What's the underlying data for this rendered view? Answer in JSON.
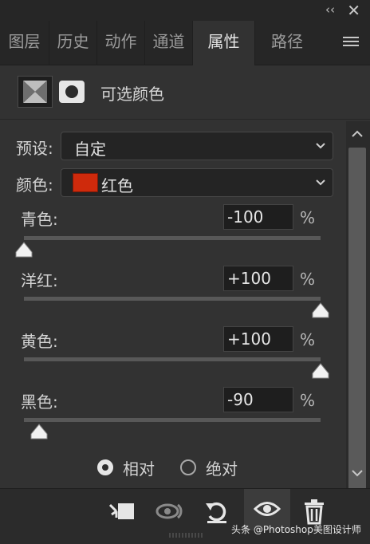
{
  "window": {
    "collapse_icon": "double-chevron-icon",
    "close_icon": "close-icon",
    "collapse_glyph": "‹‹",
    "close_glyph": "✕"
  },
  "tabs": [
    {
      "label": "图层",
      "active": false
    },
    {
      "label": "历史",
      "active": false
    },
    {
      "label": "动作",
      "active": false
    },
    {
      "label": "通道",
      "active": false
    },
    {
      "label": "属性",
      "active": true
    },
    {
      "label": "路径",
      "active": false
    }
  ],
  "panel": {
    "title": "可选颜色"
  },
  "preset": {
    "label": "预设:",
    "value": "自定"
  },
  "colors": {
    "label": "颜色:",
    "value": "红色",
    "swatch": "#cf2a0c"
  },
  "sliders": [
    {
      "label": "青色:",
      "value": "-100",
      "unit": "%",
      "level": -100
    },
    {
      "label": "洋红:",
      "value": "+100",
      "unit": "%",
      "level": 100
    },
    {
      "label": "黄色:",
      "value": "+100",
      "unit": "%",
      "level": 100
    },
    {
      "label": "黑色:",
      "value": "-90",
      "unit": "%",
      "level": -90
    }
  ],
  "method": {
    "relative": {
      "label": "相对",
      "checked": true
    },
    "absolute": {
      "label": "绝对",
      "checked": false
    }
  },
  "footer": {
    "watermark": "头条 @Photoshop美图设计师"
  },
  "theme": {
    "accent_swatch": "#cf2a0c",
    "panel_bg": "#323232",
    "tab_bg": "#262626"
  }
}
